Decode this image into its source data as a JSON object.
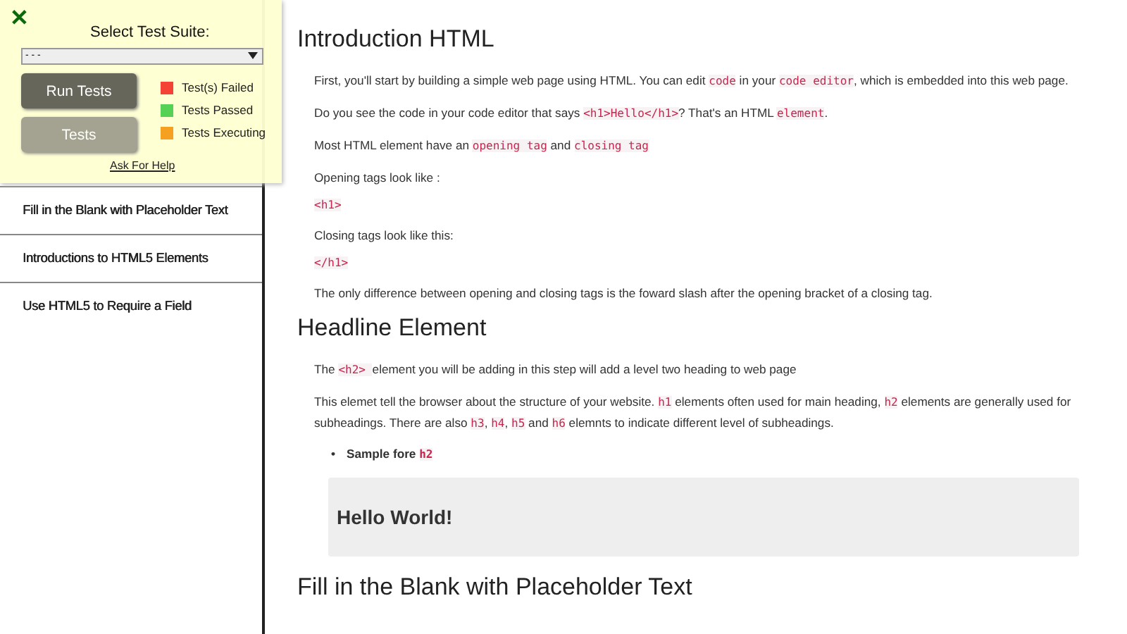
{
  "test_panel": {
    "close": "✕",
    "title": "Select Test Suite:",
    "suite_select": {
      "value": "- - -"
    },
    "buttons": [
      {
        "label": "Run Tests",
        "disabled": false
      },
      {
        "label": "Tests",
        "disabled": true
      }
    ],
    "legend": [
      {
        "label": "Test(s) Failed",
        "color": "#f44336"
      },
      {
        "label": "Tests Passed",
        "color": "#55d155"
      },
      {
        "label": "Tests Executing",
        "color": "#f5a020"
      }
    ],
    "help_link": "Ask For Help"
  },
  "sidebar": {
    "items": [
      {
        "label": "Fill in the Blank with Placeholder Text"
      },
      {
        "label": "Introductions to HTML5 Elements"
      },
      {
        "label": "Use HTML5 to Require a Field"
      }
    ]
  },
  "sections": [
    {
      "heading": "Introduction HTML",
      "blocks": [
        {
          "kind": "paragraph",
          "segments": [
            {
              "text": "First, you'll start by building a simple web page using HTML. You can edit ",
              "code": false
            },
            {
              "text": "code",
              "code": true
            },
            {
              "text": " in your ",
              "code": false
            },
            {
              "text": "code editor",
              "code": true
            },
            {
              "text": ", which is embedded into this web page.",
              "code": false
            }
          ]
        },
        {
          "kind": "paragraph",
          "segments": [
            {
              "text": "Do you see the code in your code editor that says ",
              "code": false
            },
            {
              "text": "<h1>Hello</h1>",
              "code": true
            },
            {
              "text": "? That's an HTML ",
              "code": false
            },
            {
              "text": "element",
              "code": true
            },
            {
              "text": ".",
              "code": false
            }
          ]
        },
        {
          "kind": "paragraph",
          "segments": [
            {
              "text": "Most HTML element have an ",
              "code": false
            },
            {
              "text": "opening tag",
              "code": true
            },
            {
              "text": " and ",
              "code": false
            },
            {
              "text": "closing tag",
              "code": true
            }
          ]
        },
        {
          "kind": "paragraph",
          "segments": [
            {
              "text": "Opening tags look like :",
              "code": false
            }
          ]
        },
        {
          "kind": "code",
          "text": "<h1>"
        },
        {
          "kind": "paragraph",
          "segments": [
            {
              "text": "Closing tags look like this:",
              "code": false
            }
          ]
        },
        {
          "kind": "code",
          "text": "</h1>"
        },
        {
          "kind": "paragraph",
          "segments": [
            {
              "text": "The only difference between opening and closing tags is the foward slash after the opening bracket of a closing tag.",
              "code": false
            }
          ]
        }
      ]
    },
    {
      "heading": "Headline Element",
      "blocks": [
        {
          "kind": "paragraph",
          "segments": [
            {
              "text": "The ",
              "code": false
            },
            {
              "text": "<h2> ",
              "code": true
            },
            {
              "text": " element you will be adding in this step will add a level two heading to web page",
              "code": false
            }
          ]
        },
        {
          "kind": "paragraph",
          "segments": [
            {
              "text": "This elemet tell the browser about the structure of your website. ",
              "code": false
            },
            {
              "text": "h1",
              "code": true
            },
            {
              "text": " elements often used for main heading, ",
              "code": false
            },
            {
              "text": "h2",
              "code": true
            },
            {
              "text": " elements are generally used for subheadings. There are also ",
              "code": false
            },
            {
              "text": "h3",
              "code": true
            },
            {
              "text": ", ",
              "code": false
            },
            {
              "text": "h4",
              "code": true
            },
            {
              "text": ", ",
              "code": false
            },
            {
              "text": "h5",
              "code": true
            },
            {
              "text": " and ",
              "code": false
            },
            {
              "text": "h6",
              "code": true
            },
            {
              "text": " elemnts to indicate different level of subheadings.",
              "code": false
            }
          ]
        },
        {
          "kind": "bullet",
          "marker": "•",
          "segments": [
            {
              "text": "Sample fore ",
              "code": false
            },
            {
              "text": "h2",
              "code": true
            }
          ]
        },
        {
          "kind": "sample",
          "text": "Hello World!"
        }
      ]
    },
    {
      "heading": "Fill in the Blank with Placeholder Text"
    }
  ]
}
